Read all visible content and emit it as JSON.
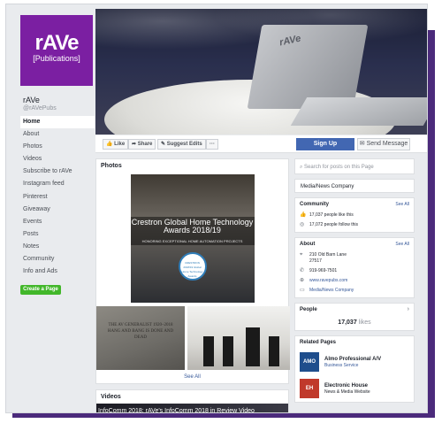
{
  "page": {
    "logo": {
      "brand": "rAVe",
      "sub": "[Publications]"
    },
    "name": "rAVe",
    "handle": "@rAVePubs"
  },
  "nav": [
    "Home",
    "About",
    "Photos",
    "Videos",
    "Subscribe to rAVe",
    "Instagram feed",
    "Pinterest",
    "Giveaway",
    "Events",
    "Posts",
    "Notes",
    "Community",
    "Info and Ads"
  ],
  "create_page": "Create a Page",
  "cover": {
    "laptop_mark": "rAVe"
  },
  "actions": {
    "like": "Like",
    "share": "Share",
    "suggest": "Suggest Edits",
    "more": "···",
    "signup": "Sign Up",
    "send_message": "Send Message"
  },
  "photos": {
    "title": "Photos",
    "award_title": "Crestron Global Home Technology Awards 2018/19",
    "award_sub": "HONORING EXCEPTIONAL HOME AUTOMATION PROJECTS",
    "award_seal": "CRESTRON 2018/19 Global Home Technology Awards",
    "stone_text": "THE AV GENERALIST 1920–2018 HANG AND BANG IS DONE AND DEAD",
    "see_all": "See All"
  },
  "videos": {
    "title": "Videos",
    "caption": "InfoComm 2018: rAVe's InfoComm 2018 in Review Video"
  },
  "right": {
    "search_placeholder": "Search for posts on this Page",
    "category": "Media/News Company",
    "community": {
      "title": "Community",
      "see_all": "See All",
      "likes": "17,037 people like this",
      "follows": "17,072 people follow this"
    },
    "about": {
      "title": "About",
      "see_all": "See All",
      "address1": "210 Old Barn Lane",
      "address2": "27517",
      "phone": "919-969-7501",
      "website": "www.ravepubs.com",
      "category": "Media/News Company"
    },
    "people": {
      "title": "People",
      "count": "17,037",
      "count_label": "likes"
    },
    "related": {
      "title": "Related Pages",
      "items": [
        {
          "logo": "AMO",
          "name": "Almo Professional A/V",
          "category": "Business Service",
          "color": "#1f4e8c"
        },
        {
          "logo": "EH",
          "name": "Electronic House",
          "category": "News & Media Website",
          "color": "#c0392b"
        }
      ]
    }
  },
  "colors": {
    "brand": "#7b1fa2",
    "facebook_blue": "#4267b2",
    "frame_shadow": "#4b2a7b",
    "create_green": "#42b72a"
  }
}
